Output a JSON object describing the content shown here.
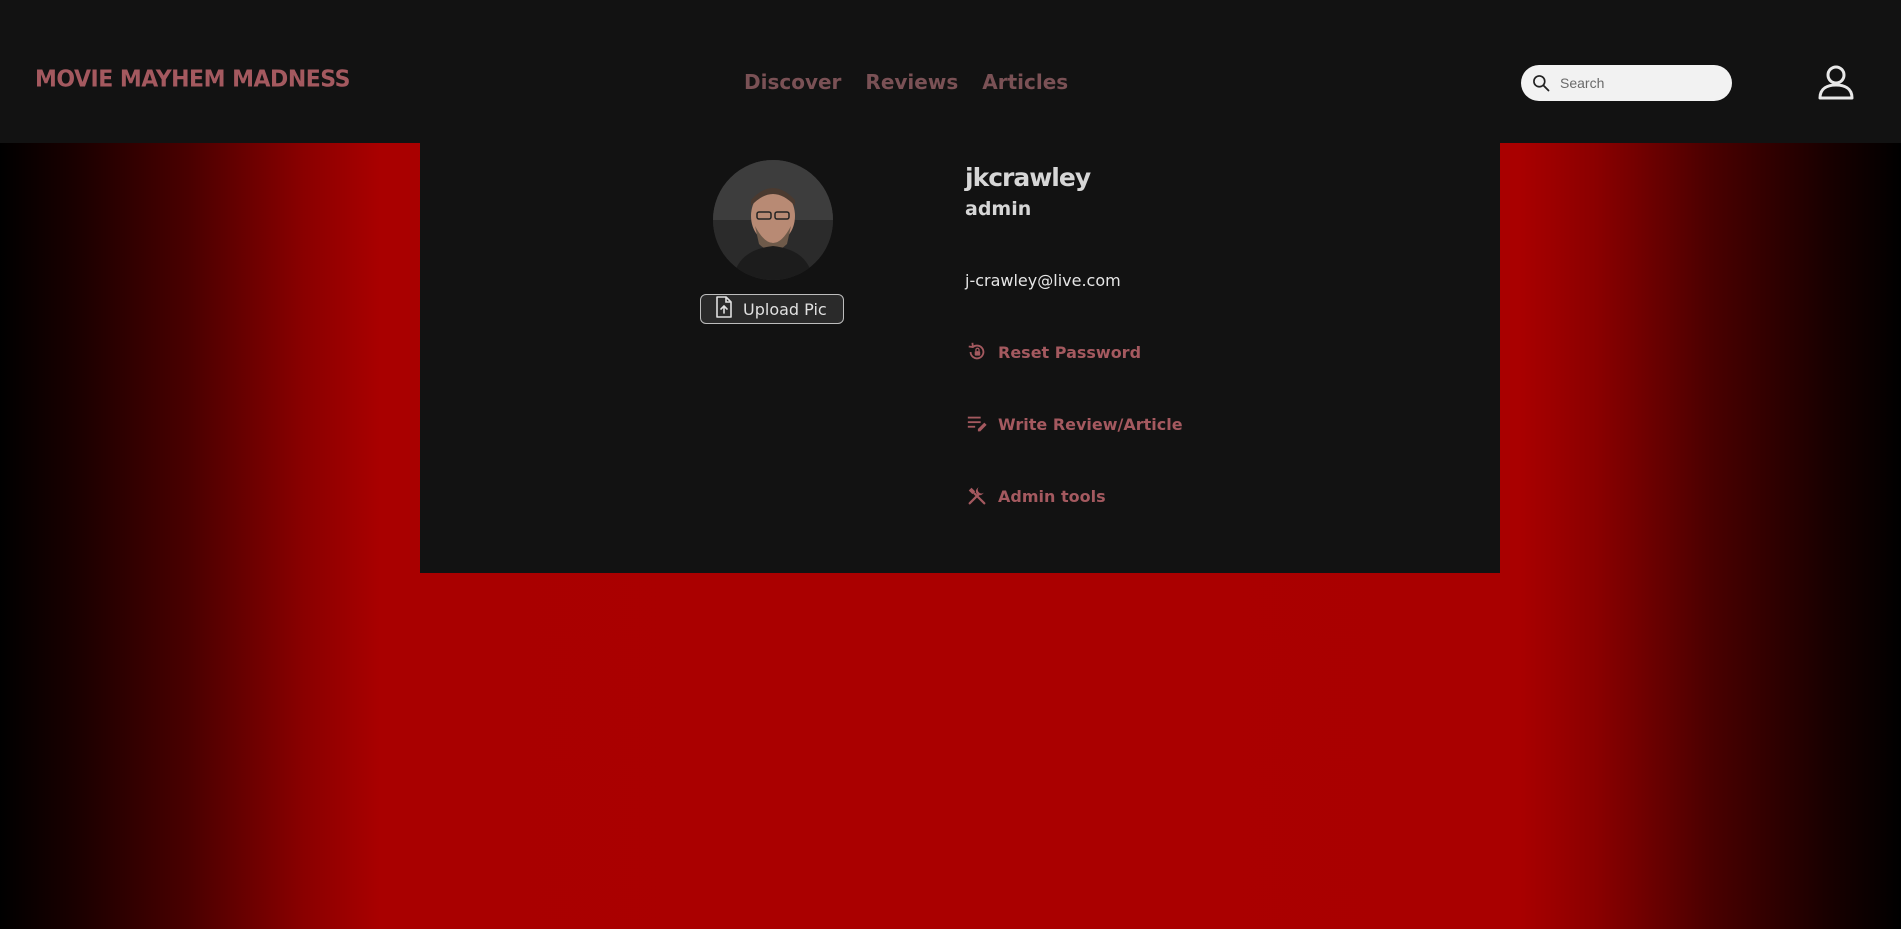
{
  "header": {
    "logo": "MOVIE MAYHEM MADNESS",
    "nav": [
      "Discover",
      "Reviews",
      "Articles"
    ],
    "search_placeholder": "Search"
  },
  "profile": {
    "username": "jkcrawley",
    "role": "admin",
    "email": "j-crawley@live.com",
    "upload_label": "Upload Pic",
    "actions": [
      {
        "label": "Reset Password",
        "icon": "lock-reset-icon"
      },
      {
        "label": "Write Review/Article",
        "icon": "edit-note-icon"
      },
      {
        "label": "Admin tools",
        "icon": "tools-icon"
      }
    ]
  },
  "colors": {
    "accent": "#a4595f",
    "nav": "#7a5155",
    "panel": "#121212",
    "background_red": "#aa0000"
  }
}
